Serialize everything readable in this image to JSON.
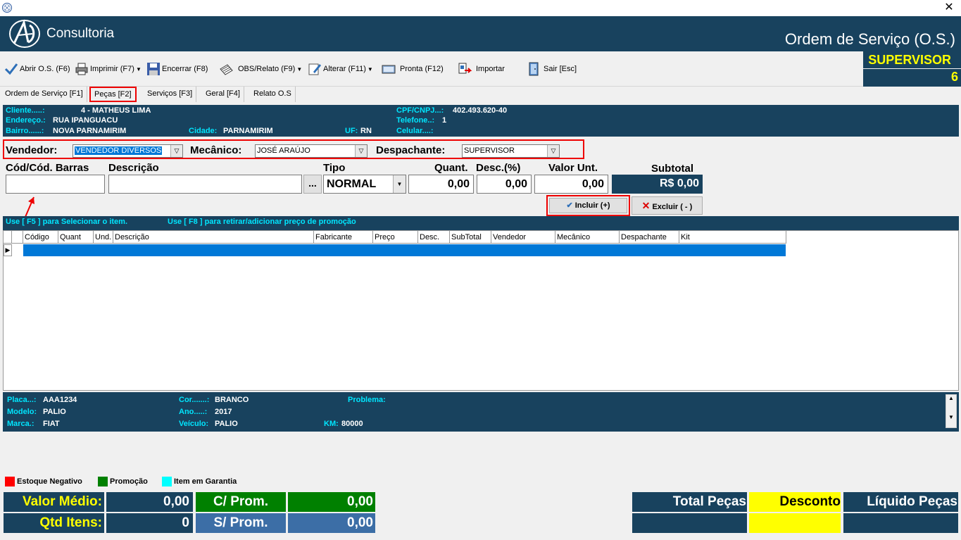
{
  "header": {
    "logo_text": "Consultoria",
    "title": "Ordem de Serviço (O.S.)",
    "user": "SUPERVISOR",
    "user_number": "6"
  },
  "toolbar": {
    "abrir": "Abrir O.S. (F6)",
    "imprimir": "Imprimir  (F7)",
    "encerrar": "Encerrar (F8)",
    "obs": "OBS/Relato (F9)",
    "alterar": "Alterar (F11)",
    "pronta": "Pronta (F12)",
    "importar": "Importar",
    "sair": "Sair [Esc]"
  },
  "tabs": [
    "Ordem de Serviço [F1]",
    "Peças [F2]",
    "Serviços [F3]",
    "Geral [F4]",
    "Relato O.S"
  ],
  "client": {
    "cliente_label": "Cliente.....:",
    "cliente": "4 - MATHEUS LIMA",
    "endereco_label": "Endereço.:",
    "endereco": "RUA IPANGUACU",
    "bairro_label": "Bairro......:",
    "bairro": "NOVA PARNAMIRIM",
    "cidade_label": "Cidade:",
    "cidade": "PARNAMIRIM",
    "uf_label": "UF:",
    "uf": "RN",
    "cpf_label": "CPF/CNPJ...:",
    "cpf": "402.493.620-40",
    "telefone_label": "Telefone..:",
    "telefone": "1",
    "celular_label": "Celular....:",
    "celular": ""
  },
  "staff": {
    "vendedor_label": "Vendedor:",
    "vendedor": "VENDEDOR DIVERSOS",
    "mecanico_label": "Mecânico:",
    "mecanico": "JOSÉ ARAÚJO",
    "despachante_label": "Despachante:",
    "despachante": "SUPERVISOR"
  },
  "item_form": {
    "cod_label": "Cód/Cód. Barras",
    "desc_label": "Descrição",
    "tipo_label": "Tipo",
    "quant_label": "Quant.",
    "descpct_label": "Desc.(%)",
    "valor_label": "Valor Unt.",
    "subtotal_label": "Subtotal",
    "tipo": "NORMAL",
    "quant": "0,00",
    "descpct": "0,00",
    "valor": "0,00",
    "subtotal": "R$ 0,00",
    "browse": "...",
    "incluir": "Incluir (+)",
    "excluir": "Excluir ( - )"
  },
  "hints": {
    "f5": "Use [ F5 ] para Selecionar o item.",
    "f8": "Use [ F8 ] para retirar/adicionar preço de promoção"
  },
  "grid_columns": [
    "Código",
    "Quant",
    "Und.",
    "Descrição",
    "Fabricante",
    "Preço",
    "Desc.",
    "SubTotal",
    "Vendedor",
    "Mecânico",
    "Despachante",
    "Kit"
  ],
  "vehicle": {
    "placa_label": "Placa...:",
    "placa": "AAA1234",
    "modelo_label": "Modelo:",
    "modelo": "PALIO",
    "marca_label": "Marca.:",
    "marca": "FIAT",
    "cor_label": "Cor.......:",
    "cor": "BRANCO",
    "ano_label": "Ano.....:",
    "ano": "2017",
    "veiculo_label": "Veículo:",
    "veiculo": "PALIO",
    "km_label": "KM:",
    "km": "80000",
    "problema_label": "Problema:"
  },
  "legend": {
    "negativo": "Estoque Negativo",
    "promocao": "Promoção",
    "garantia": "Item em Garantia",
    "colors": {
      "negativo": "#ff0000",
      "promocao": "#008000",
      "garantia": "#00ffff"
    }
  },
  "totals": {
    "valor_medio_label": "Valor Médio:",
    "valor_medio": "0,00",
    "qtd_itens_label": "Qtd Itens:",
    "qtd_itens": "0",
    "c_prom_label": "C/ Prom.",
    "c_prom": "0,00",
    "s_prom_label": "S/ Prom.",
    "s_prom": "0,00",
    "total_pecas_label": "Total Peças",
    "desconto_label": "Desconto",
    "liquido_label": "Líquido Peças"
  }
}
